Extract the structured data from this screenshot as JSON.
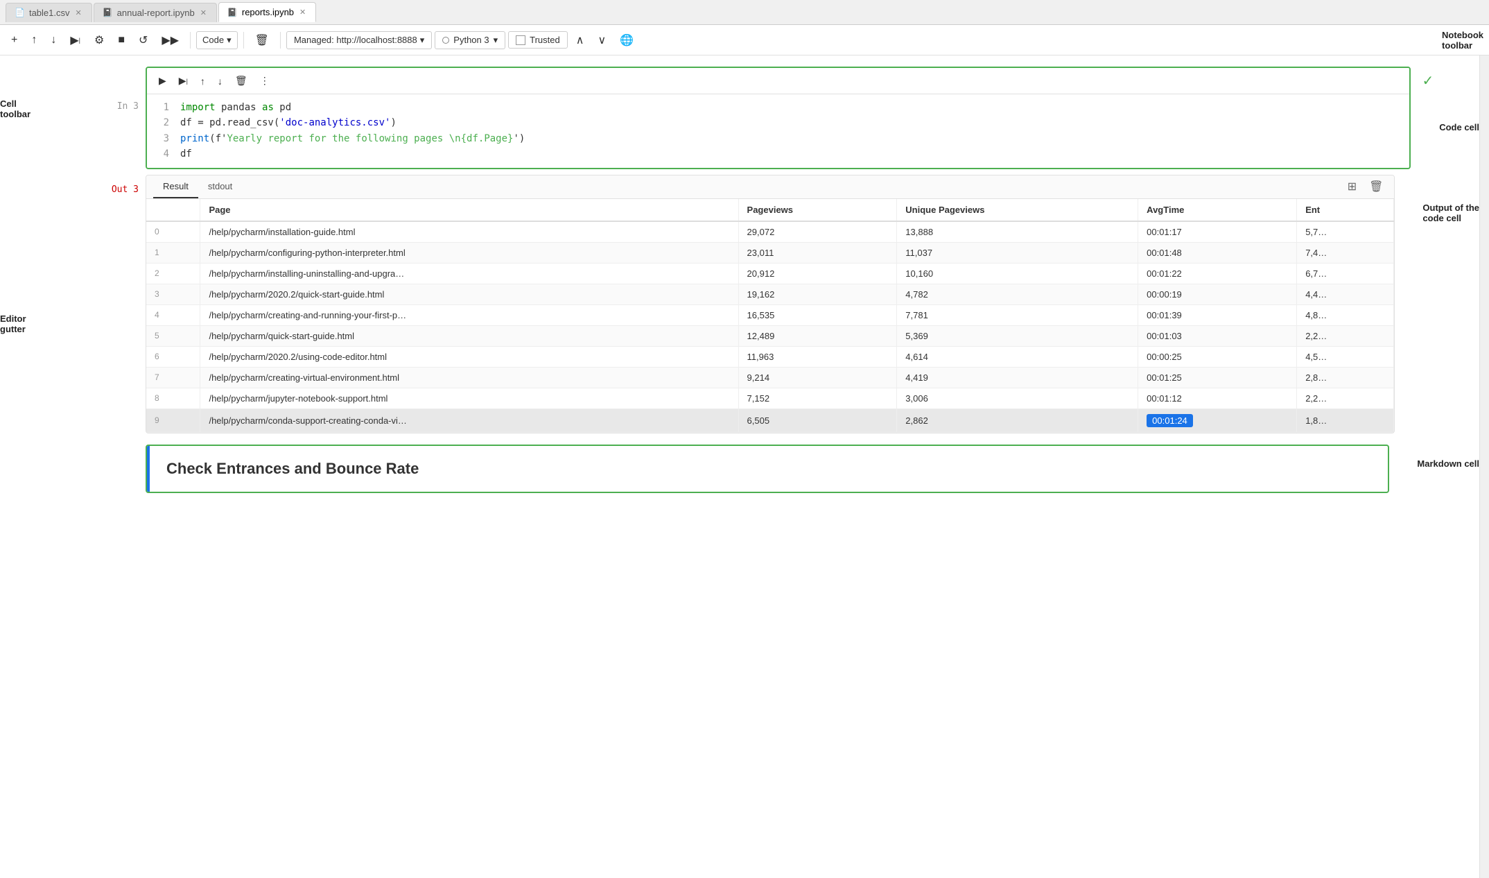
{
  "tabs": [
    {
      "id": "tab-table1",
      "label": "table1.csv",
      "icon": "📄",
      "active": false
    },
    {
      "id": "tab-annual",
      "label": "annual-report.ipynb",
      "icon": "📓",
      "active": false
    },
    {
      "id": "tab-reports",
      "label": "reports.ipynb",
      "icon": "📓",
      "active": true
    }
  ],
  "toolbar": {
    "add_label": "+",
    "move_up_label": "↑",
    "move_down_label": "↓",
    "run_label": "▶",
    "run_cursor_label": "▶|",
    "stop_label": "■",
    "restart_label": "↺",
    "run_all_label": "▶▶",
    "cell_type_label": "Code",
    "delete_label": "🗑",
    "kernel_label": "Managed: http://localhost:8888",
    "python_label": "Python 3",
    "trusted_label": "Trusted",
    "nav_up_label": "∧",
    "nav_down_label": "∨",
    "globe_label": "🌐"
  },
  "cell": {
    "prompt_in": "In 3",
    "prompt_out": "Out 3",
    "lines": [
      {
        "num": "1",
        "content_html": "<span class='kw'>import</span> pandas <span class='kw'>as</span> pd"
      },
      {
        "num": "2",
        "content_html": "df = pd.read_csv(<span class='str'>'doc-analytics.csv'</span>)"
      },
      {
        "num": "3",
        "content_html": "<span class='fn'>print</span>(f'Yearly report for the following pages \\n{df.Page}')"
      },
      {
        "num": "4",
        "content_html": "df"
      }
    ]
  },
  "output": {
    "tabs": [
      "Result",
      "stdout"
    ],
    "active_tab": "Result",
    "table": {
      "columns": [
        "Page",
        "Pageviews",
        "Unique Pageviews",
        "AvgTime",
        "Ent"
      ],
      "rows": [
        {
          "idx": "",
          "page": "/help/pycharm/installation-guide.html",
          "pageviews": "29,072",
          "unique": "13,888",
          "avgtime": "00:01:17",
          "ent": "5,7…",
          "highlighted": false,
          "highlight_time": false
        },
        {
          "idx": "",
          "page": "/help/pycharm/configuring-python-interpreter.html",
          "pageviews": "23,011",
          "unique": "11,037",
          "avgtime": "00:01:48",
          "ent": "7,4…",
          "highlighted": false,
          "highlight_time": false
        },
        {
          "idx": "",
          "page": "/help/pycharm/installing-uninstalling-and-upgra…",
          "pageviews": "20,912",
          "unique": "10,160",
          "avgtime": "00:01:22",
          "ent": "6,7…",
          "highlighted": false,
          "highlight_time": false
        },
        {
          "idx": "",
          "page": "/help/pycharm/2020.2/quick-start-guide.html",
          "pageviews": "19,162",
          "unique": "4,782",
          "avgtime": "00:00:19",
          "ent": "4,4…",
          "highlighted": false,
          "highlight_time": false
        },
        {
          "idx": "",
          "page": "/help/pycharm/creating-and-running-your-first-p…",
          "pageviews": "16,535",
          "unique": "7,781",
          "avgtime": "00:01:39",
          "ent": "4,8…",
          "highlighted": false,
          "highlight_time": false
        },
        {
          "idx": "",
          "page": "/help/pycharm/quick-start-guide.html",
          "pageviews": "12,489",
          "unique": "5,369",
          "avgtime": "00:01:03",
          "ent": "2,2…",
          "highlighted": false,
          "highlight_time": false
        },
        {
          "idx": "",
          "page": "/help/pycharm/2020.2/using-code-editor.html",
          "pageviews": "11,963",
          "unique": "4,614",
          "avgtime": "00:00:25",
          "ent": "4,5…",
          "highlighted": false,
          "highlight_time": false
        },
        {
          "idx": "",
          "page": "/help/pycharm/creating-virtual-environment.html",
          "pageviews": "9,214",
          "unique": "4,419",
          "avgtime": "00:01:25",
          "ent": "2,8…",
          "highlighted": false,
          "highlight_time": false
        },
        {
          "idx": "",
          "page": "/help/pycharm/jupyter-notebook-support.html",
          "pageviews": "7,152",
          "unique": "3,006",
          "avgtime": "00:01:12",
          "ent": "2,2…",
          "highlighted": false,
          "highlight_time": false
        },
        {
          "idx": "",
          "page": "/help/pycharm/conda-support-creating-conda-vi…",
          "pageviews": "6,505",
          "unique": "2,862",
          "avgtime": "00:01:24",
          "ent": "1,8…",
          "highlighted": true,
          "highlight_time": true
        }
      ]
    }
  },
  "markdown": {
    "content": "Check Entrances and Bounce Rate"
  },
  "annotations": {
    "notebook_toolbar": "Notebook\ntoolbar",
    "cell_toolbar": "Cell\ntoolbar",
    "code_cell": "Code cell",
    "editor_gutter": "Editor\ngutter",
    "output_of_code_cell": "Output of the\ncode cell",
    "markdown_cell": "Markdown cell"
  }
}
